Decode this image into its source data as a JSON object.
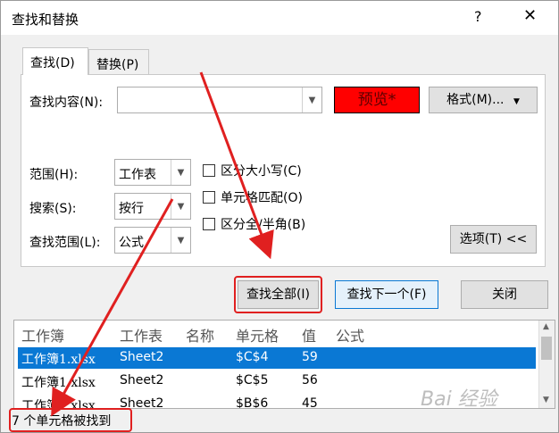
{
  "window": {
    "title": "查找和替换",
    "help_label": "?",
    "close_label": "✕"
  },
  "tabs": [
    {
      "label": "查找(D)"
    },
    {
      "label": "替换(P)"
    }
  ],
  "find": {
    "label": "查找内容(N):",
    "value": "",
    "preview_label": "预览*",
    "format_label": "格式(M)..."
  },
  "options": {
    "within": {
      "label": "范围(H):",
      "value": "工作表"
    },
    "search": {
      "label": "搜索(S):",
      "value": "按行"
    },
    "lookin": {
      "label": "查找范围(L):",
      "value": "公式"
    },
    "checkboxes": [
      {
        "label": "区分大小写(C)",
        "checked": false
      },
      {
        "label": "单元格匹配(O)",
        "checked": false
      },
      {
        "label": "区分全/半角(B)",
        "checked": false
      }
    ],
    "options_button": "选项(T) <<"
  },
  "buttons": {
    "find_all": "查找全部(I)",
    "find_next": "查找下一个(F)",
    "close": "关闭"
  },
  "results": {
    "columns": [
      "工作簿",
      "工作表",
      "名称",
      "单元格",
      "值",
      "公式"
    ],
    "rows": [
      {
        "book": "工作簿1.xlsx",
        "sheet": "Sheet2",
        "name": "",
        "cell": "$C$4",
        "value": "59",
        "formula": "",
        "selected": true
      },
      {
        "book": "工作簿1.xlsx",
        "sheet": "Sheet2",
        "name": "",
        "cell": "$C$5",
        "value": "56",
        "formula": "",
        "selected": false
      },
      {
        "book": "工作簿1.xlsx",
        "sheet": "Sheet2",
        "name": "",
        "cell": "$B$6",
        "value": "45",
        "formula": "",
        "selected": false
      }
    ]
  },
  "status_text": "7 个单元格被找到",
  "watermark": "Bai 经验",
  "colors": {
    "highlight": "#e02020",
    "selection": "#0a78d4",
    "preview_bg": "#ff0000"
  }
}
